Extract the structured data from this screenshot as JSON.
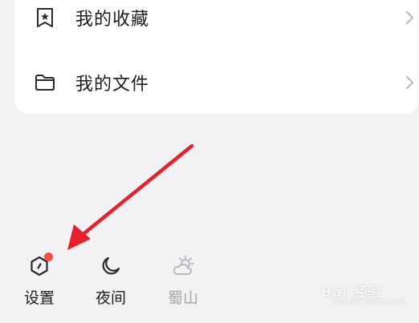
{
  "menu": {
    "items": [
      {
        "label": "我的收藏",
        "icon": "bookmark-star-icon"
      },
      {
        "label": "我的文件",
        "icon": "folder-icon"
      }
    ]
  },
  "bottom_tools": [
    {
      "label": "设置",
      "icon": "settings-hexagon-icon",
      "has_badge": true
    },
    {
      "label": "夜间",
      "icon": "moon-icon"
    },
    {
      "label": "蜀山",
      "icon": "weather-sun-cloud-icon",
      "state": "disabled"
    }
  ],
  "annotation": {
    "arrow_color": "#e8202a"
  },
  "watermark": {
    "logo_text": "Bai 经验",
    "url": "jingyan.baidu.com"
  },
  "colors": {
    "background": "#f2f2f4",
    "card": "#ffffff",
    "badge": "#ff4a3d",
    "disabled_text": "#a8a8ac"
  }
}
